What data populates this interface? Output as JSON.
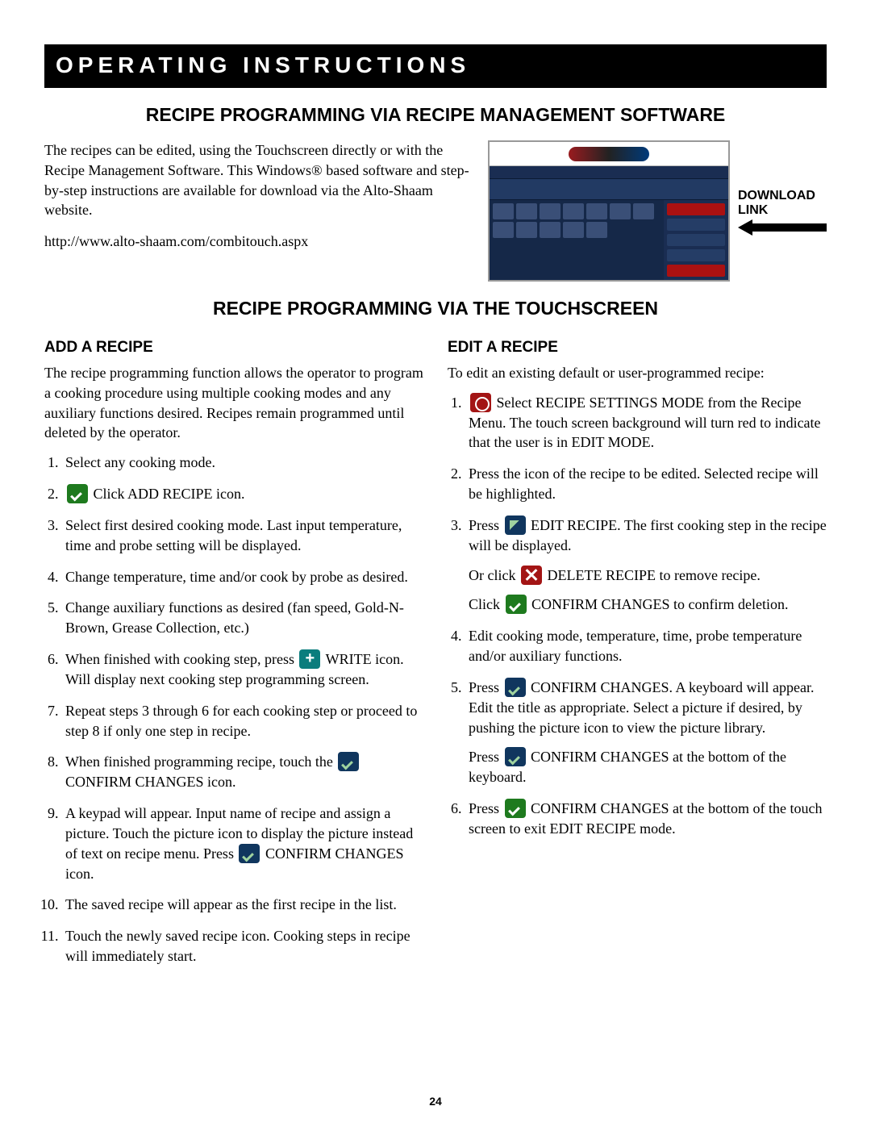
{
  "banner": "OPERATING INSTRUCTIONS",
  "section1_title": "RECIPE PROGRAMMING VIA RECIPE MANAGEMENT SOFTWARE",
  "intro_p1": "The recipes can be edited, using the Touchscreen directly or with the Recipe Management Software. This Windows® based software and step-by-step instructions are available for download via the Alto-Shaam website.",
  "intro_url": "http://www.alto-shaam.com/combitouch.aspx",
  "download_label_1": "DOWNLOAD",
  "download_label_2": "LINK",
  "section2_title": "RECIPE PROGRAMMING VIA THE TOUCHSCREEN",
  "add_title": "ADD A RECIPE",
  "add_intro": "The recipe programming function allows the operator to program a cooking procedure using multiple cooking modes and any auxiliary functions desired. Recipes remain programmed until deleted by the operator.",
  "add_steps": {
    "s1": "Select any cooking mode.",
    "s2a": "Click ADD RECIPE icon.",
    "s3": "Select first desired cooking mode. Last input temperature, time and probe setting will be displayed.",
    "s4": "Change temperature, time and/or cook by probe as desired.",
    "s5": "Change auxiliary functions as desired (fan speed, Gold-N-Brown, Grease Collection, etc.)",
    "s6a": "When finished with cooking step, press",
    "s6b": "WRITE icon. Will display next cooking step programming screen.",
    "s7": "Repeat steps 3 through 6 for each cooking step or proceed to step 8 if only one step in recipe.",
    "s8a": "When finished programming recipe, touch the",
    "s8b": "CONFIRM CHANGES icon.",
    "s9a": "A keypad will appear. Input name of recipe and assign a picture. Touch the picture icon to display the picture instead of text on recipe menu. Press",
    "s9b": "CONFIRM CHANGES icon.",
    "s10": "The saved recipe will appear as the first recipe in the list.",
    "s11": "Touch the newly saved recipe icon. Cooking steps in recipe will immediately start."
  },
  "edit_title": "EDIT A RECIPE",
  "edit_intro": "To edit an existing default or user-programmed recipe:",
  "edit_steps": {
    "s1a": "Select RECIPE SETTINGS MODE from the Recipe Menu. The touch screen background will turn red to indicate that the user is in EDIT MODE.",
    "s2": "Press the icon of the recipe to be edited. Selected recipe will be highlighted.",
    "s3a": "Press",
    "s3b": "EDIT RECIPE. The first cooking step in the recipe will be displayed.",
    "s3c": "Or click",
    "s3d": "DELETE RECIPE to remove recipe.",
    "s3e": "Click",
    "s3f": "CONFIRM CHANGES to confirm deletion.",
    "s4": "Edit cooking mode, temperature, time, probe temperature and/or auxiliary functions.",
    "s5a": "Press",
    "s5b": "CONFIRM CHANGES. A keyboard will appear. Edit the title as appropriate. Select a picture if desired, by pushing the picture icon to view the picture library.",
    "s5c": "Press",
    "s5d": "CONFIRM CHANGES at the bottom of the keyboard.",
    "s6a": "Press",
    "s6b": "CONFIRM CHANGES at the bottom of the touch screen to exit EDIT RECIPE mode."
  },
  "page_number": "24"
}
